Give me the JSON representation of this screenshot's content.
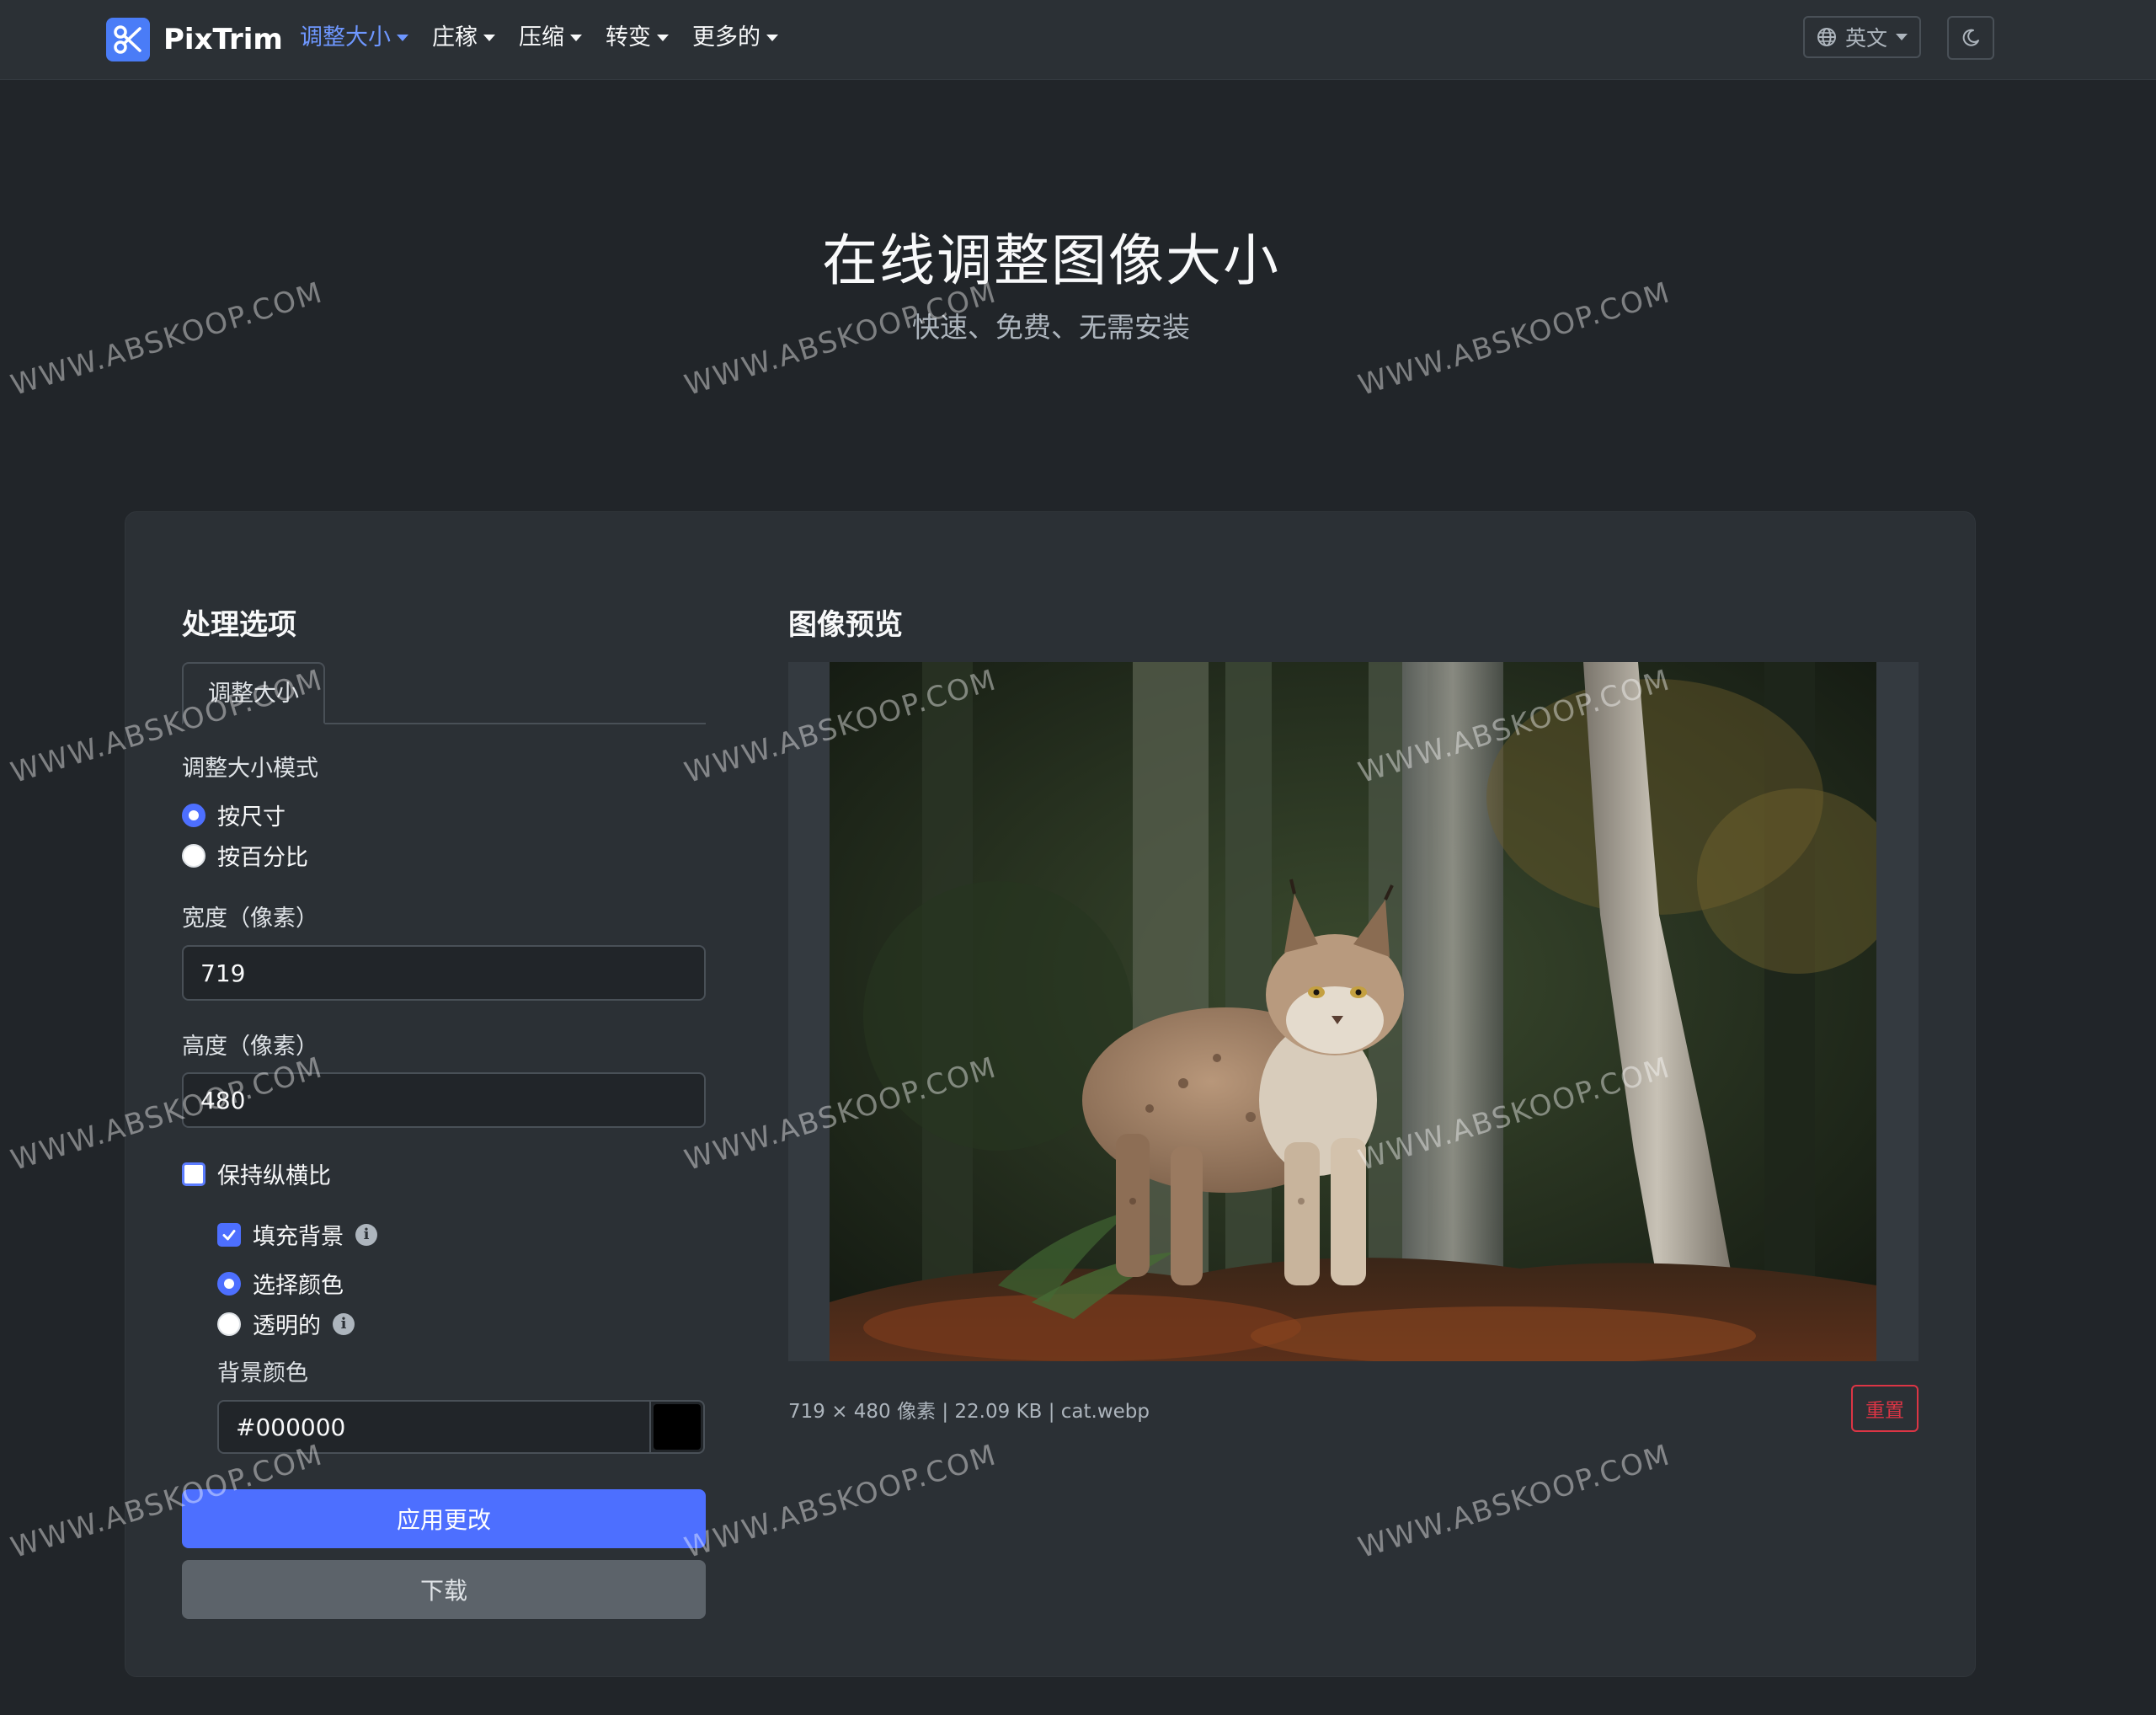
{
  "nav": {
    "brand": "PixTrim",
    "items": [
      {
        "label": "调整大小",
        "active": true
      },
      {
        "label": "庄稼",
        "active": false
      },
      {
        "label": "压缩",
        "active": false
      },
      {
        "label": "转变",
        "active": false
      },
      {
        "label": "更多的",
        "active": false
      }
    ],
    "language": "英文"
  },
  "hero": {
    "title": "在线调整图像大小",
    "subtitle": "快速、免费、无需安装"
  },
  "options": {
    "title": "处理选项",
    "tab": "调整大小",
    "mode_label": "调整大小模式",
    "mode_by_size": "按尺寸",
    "mode_by_percent": "按百分比",
    "width_label": "宽度（像素）",
    "width_value": "719",
    "height_label": "高度（像素）",
    "height_value": "480",
    "keep_ratio": "保持纵横比",
    "fill_background": "填充背景",
    "choose_color": "选择颜色",
    "transparent": "透明的",
    "bg_color_label": "背景颜色",
    "bg_color_value": "#000000",
    "apply_button": "应用更改",
    "download_button": "下载"
  },
  "preview": {
    "title": "图像预览",
    "meta": "719 × 480 像素 | 22.09 KB | cat.webp",
    "reset_button": "重置"
  },
  "watermark": "WWW.ABSKOOP.COM",
  "colors": {
    "accent": "#4d6fff",
    "background": "#212529",
    "card": "#2b3035",
    "danger": "#dc3545"
  }
}
